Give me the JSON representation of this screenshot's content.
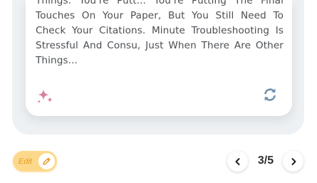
{
  "card": {
    "text": "Things. You're Putt... You're Putting The Final Touches On Your Paper, But You Still Need To Check Your Citations. Minute Troubleshooting Is Stressful And Consu, Just When There Are Other Things..."
  },
  "icons": {
    "sparkle": "sparkle-icon",
    "refresh": "refresh-icon",
    "pencil": "pencil-icon",
    "prev": "chevron-left-icon",
    "next": "chevron-right-icon"
  },
  "edit_button": {
    "label": "Edit"
  },
  "pagination": {
    "indicator": "3/5"
  },
  "colors": {
    "panel": "#eef1f3",
    "sparkle": "#d9829a",
    "refresh": "#6d8fae",
    "edit_bg": "#fcd98a",
    "edit_text": "#e59a20"
  }
}
